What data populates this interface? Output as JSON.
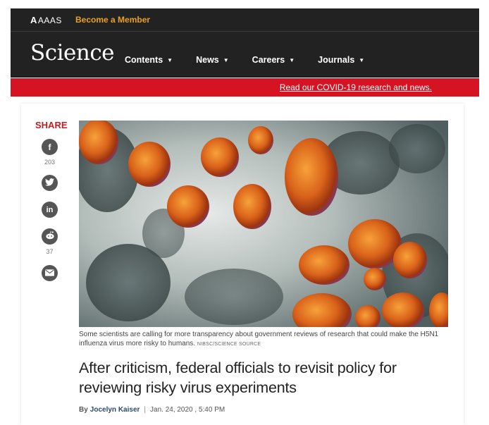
{
  "header": {
    "org_mark": "A",
    "org_name": "AAAS",
    "member_link": "Become a Member",
    "logo": "Science",
    "nav": [
      {
        "label": "Contents"
      },
      {
        "label": "News"
      },
      {
        "label": "Careers"
      },
      {
        "label": "Journals"
      }
    ]
  },
  "banner": {
    "link": "Read our COVID-19 research and news.",
    "color": "#d51323"
  },
  "share": {
    "label": "SHARE",
    "buttons": [
      {
        "icon": "facebook-icon",
        "glyph": "f",
        "count": "203"
      },
      {
        "icon": "twitter-icon",
        "glyph": "t",
        "count": ""
      },
      {
        "icon": "linkedin-icon",
        "glyph": "in",
        "count": ""
      },
      {
        "icon": "reddit-icon",
        "glyph": "r",
        "count": "37"
      },
      {
        "icon": "email-icon",
        "glyph": "✉",
        "count": ""
      }
    ]
  },
  "article": {
    "image_caption": "Some scientists are calling for more transparency about government reviews of research that could make the H5N1 influenza virus more risky to humans.",
    "image_credit": "NIBSC/SCIENCE SOURCE",
    "headline": "After criticism, federal officials to revisit policy for reviewing risky virus experiments",
    "by": "By",
    "author": "Jocelyn Kaiser",
    "date": "Jan. 24, 2020 , 5:40 PM"
  },
  "colors": {
    "accent_orange": "#e8a01e",
    "share_red": "#c41c22",
    "header_bg": "#222222"
  }
}
